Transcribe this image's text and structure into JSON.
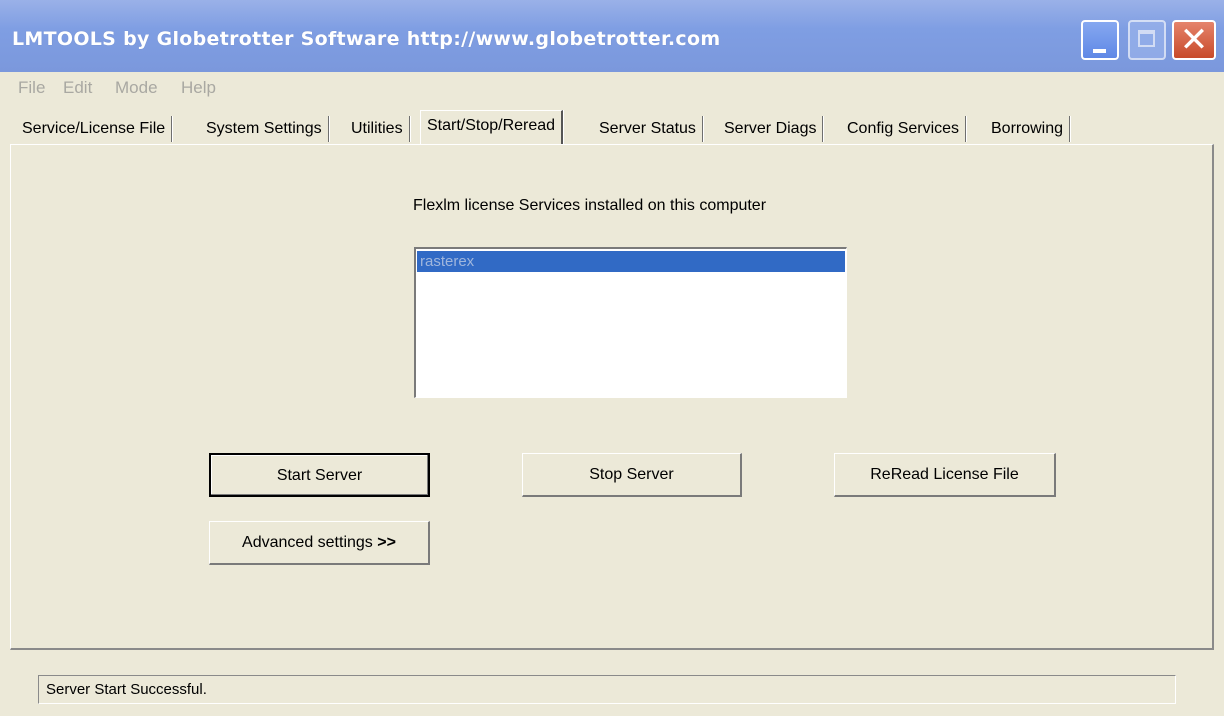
{
  "window": {
    "title": "LMTOOLS by Globetrotter Software http://www.globetrotter.com",
    "controls": {
      "minimize_icon": "minimize-icon",
      "maximize_icon": "maximize-icon",
      "close_glyph": "✕"
    }
  },
  "menu": [
    "File",
    "Edit",
    "Mode",
    "Help"
  ],
  "tabs": [
    {
      "label": "Service/License File"
    },
    {
      "label": "System Settings"
    },
    {
      "label": "Utilities"
    },
    {
      "label": "Start/Stop/Reread",
      "active": true
    },
    {
      "label": "Server Status"
    },
    {
      "label": "Server Diags"
    },
    {
      "label": "Config Services"
    },
    {
      "label": "Borrowing"
    }
  ],
  "main": {
    "heading": "Flexlm license Services installed on this computer",
    "services": [
      {
        "label": "rasterex",
        "selected": true
      }
    ],
    "buttons": {
      "start": "Start Server",
      "stop": "Stop Server",
      "reread": "ReRead License File",
      "advanced": "Advanced settings",
      "advanced_chevron": ">>"
    }
  },
  "status": {
    "text": "Server Start Successful."
  },
  "colors": {
    "title_bar": "#7f9ee3",
    "selection": "#316ac5",
    "face": "#ece9d8"
  }
}
